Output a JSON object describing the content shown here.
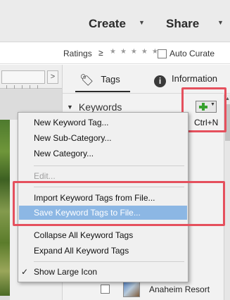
{
  "header": {
    "create_label": "Create",
    "share_label": "Share",
    "caret": "▼"
  },
  "filter": {
    "ratings_label": "Ratings",
    "ratings_operator": "≥",
    "stars": "★★★★★",
    "rating_value": 0,
    "auto_curate_label": "Auto Curate",
    "auto_curate_checked": false
  },
  "ruler": {
    "arrow": ">"
  },
  "panel": {
    "tabs": [
      {
        "label": "Tags",
        "icon": "tag-icon",
        "active": true
      },
      {
        "label": "Information",
        "icon": "info-icon",
        "icon_glyph": "i",
        "active": false
      }
    ],
    "section_title": "Keywords",
    "section_toggle": "▼",
    "add_button_caret": "▼",
    "scroll_up": "▲"
  },
  "shortcut_hint": "Ctrl+N",
  "context_menu": {
    "items": [
      {
        "label": "New Keyword Tag..."
      },
      {
        "label": "New Sub-Category..."
      },
      {
        "label": "New Category..."
      },
      {
        "label": "Edit...",
        "disabled": true
      },
      {
        "label": "Import Keyword Tags from File..."
      },
      {
        "label": "Save Keyword Tags to File...",
        "selected": true
      },
      {
        "label": "Collapse All Keyword Tags"
      },
      {
        "label": "Expand All Keyword Tags"
      },
      {
        "label": "Show Large Icon",
        "checked": true,
        "check_glyph": "✓"
      }
    ]
  },
  "keyword_list": {
    "visible_item": {
      "label": "Anaheim Resort",
      "checked": false
    }
  },
  "colors": {
    "highlight_border": "#e5505d",
    "menu_selected": "#8cb7e4",
    "add_plus": "#37a12e"
  }
}
